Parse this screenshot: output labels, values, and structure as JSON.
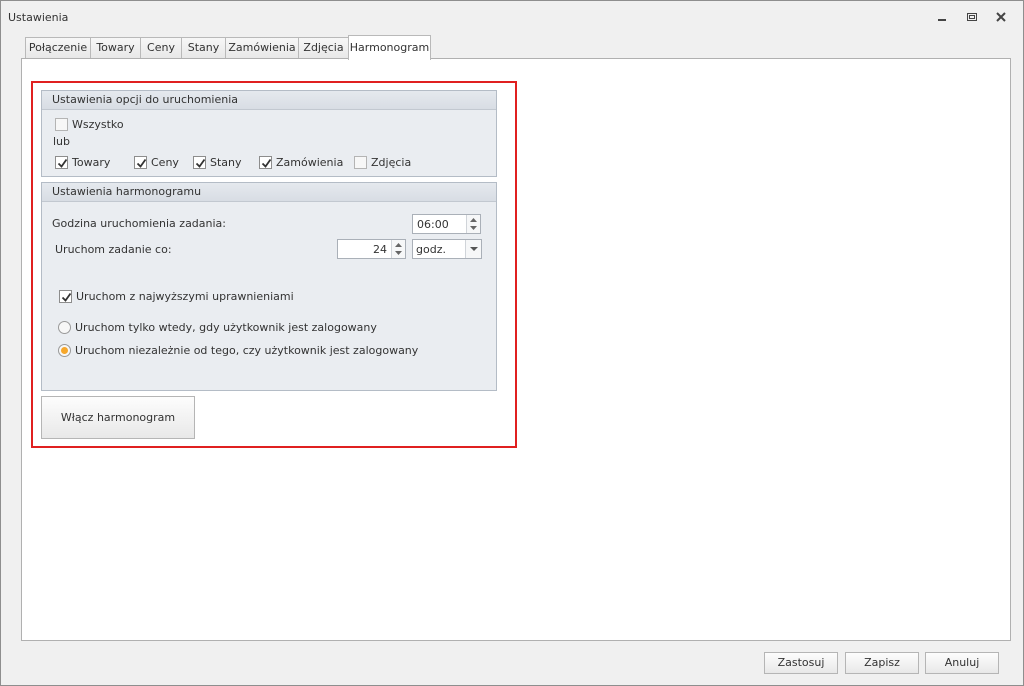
{
  "window": {
    "title": "Ustawienia"
  },
  "tabs": [
    {
      "label": "Połączenie"
    },
    {
      "label": "Towary"
    },
    {
      "label": "Ceny"
    },
    {
      "label": "Stany"
    },
    {
      "label": "Zamówienia"
    },
    {
      "label": "Zdjęcia"
    },
    {
      "label": "Harmonogram",
      "active": true
    }
  ],
  "options_group": {
    "title": "Ustawienia opcji do uruchomienia",
    "all": {
      "label": "Wszystko",
      "checked": false
    },
    "or_label": "lub",
    "items": [
      {
        "label": "Towary",
        "checked": true
      },
      {
        "label": "Ceny",
        "checked": true
      },
      {
        "label": "Stany",
        "checked": true
      },
      {
        "label": "Zamówienia",
        "checked": true
      },
      {
        "label": "Zdjęcia",
        "checked": false
      }
    ]
  },
  "schedule_group": {
    "title": "Ustawienia harmonogramu",
    "start_time_label": "Godzina uruchomienia zadania:",
    "start_time_value": "06:00",
    "interval_label": "Uruchom zadanie co:",
    "interval_value": "24",
    "interval_unit": "godz.",
    "highest_privileges": {
      "label": "Uruchom z najwyższymi uprawnieniami",
      "checked": true
    },
    "radio_logged_in": {
      "label": "Uruchom tylko wtedy, gdy użytkownik jest zalogowany",
      "selected": false
    },
    "radio_always": {
      "label": "Uruchom niezależnie od tego, czy użytkownik jest zalogowany",
      "selected": true
    }
  },
  "enable_button": "Włącz harmonogram",
  "footer": {
    "apply": "Zastosuj",
    "save": "Zapisz",
    "cancel": "Anuluj"
  },
  "colors": {
    "highlight_border": "#e02020",
    "radio_selected": "#f6a72b"
  }
}
